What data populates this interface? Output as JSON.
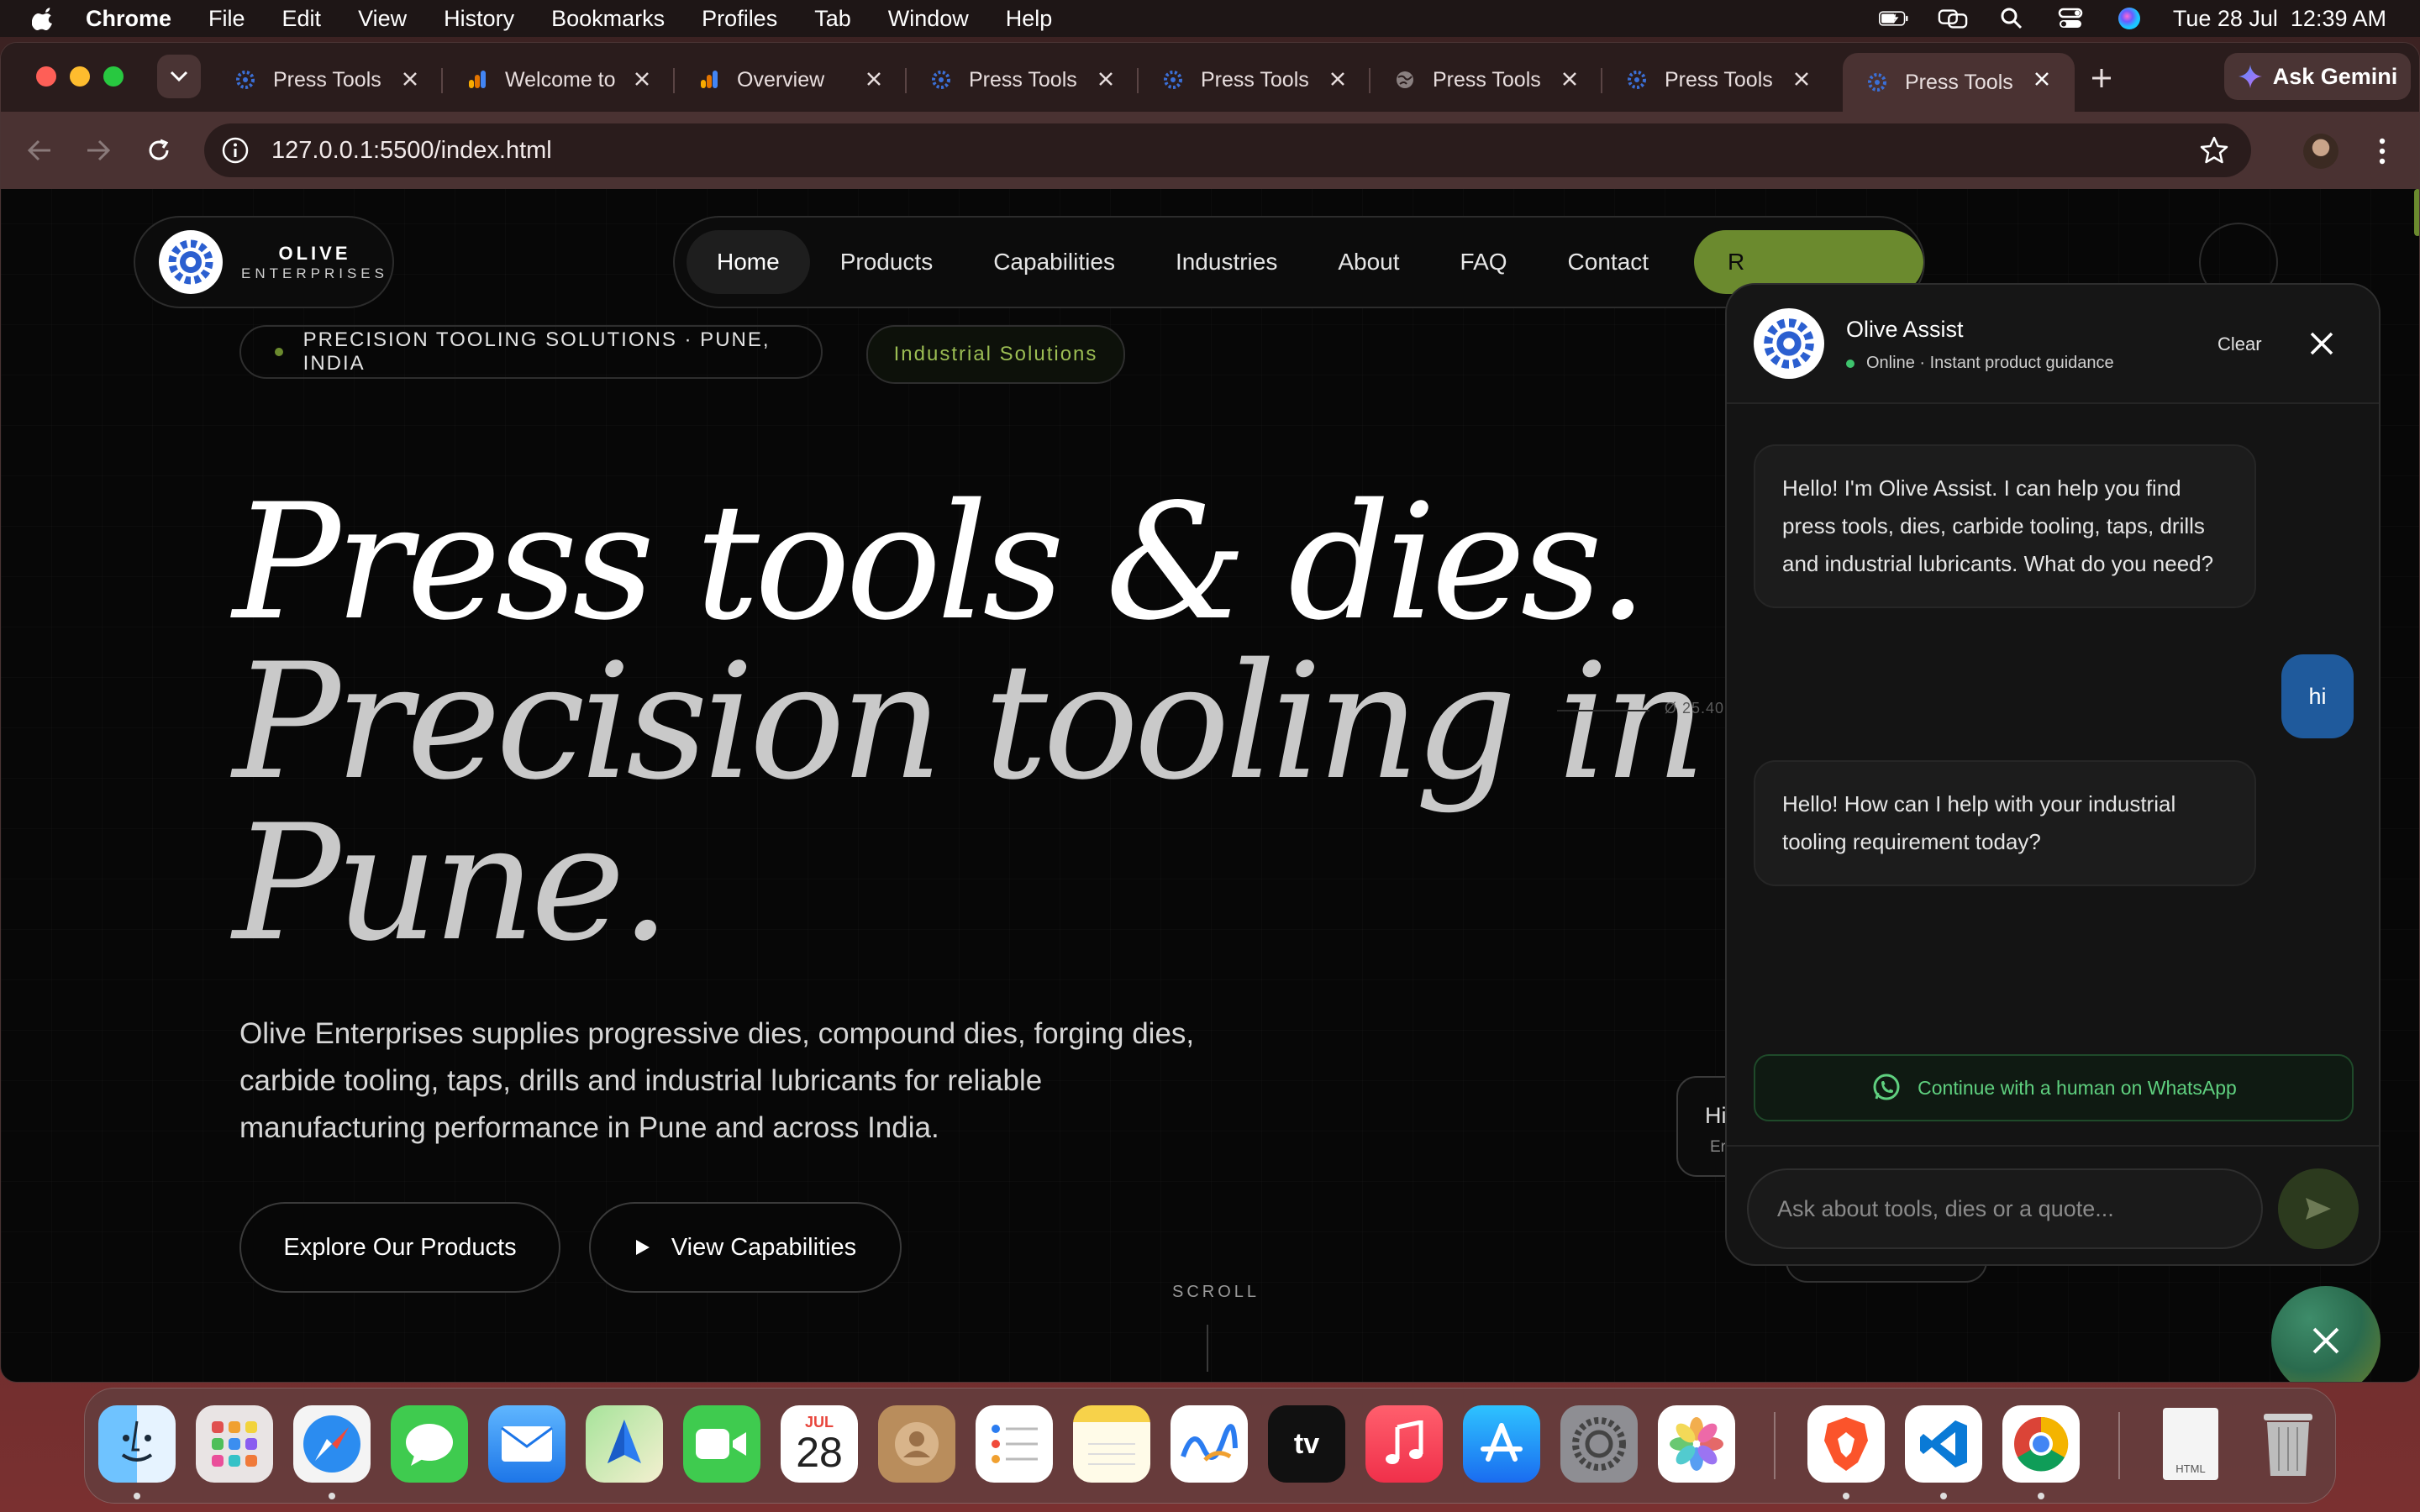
{
  "menubar": {
    "app": "Chrome",
    "items": [
      "File",
      "Edit",
      "View",
      "History",
      "Bookmarks",
      "Profiles",
      "Tab",
      "Window",
      "Help"
    ],
    "clock": "Tue 28 Jul  12:39 AM"
  },
  "browser": {
    "tabs": [
      {
        "title": "Press Tools",
        "favicon": "gear-favicon-icon"
      },
      {
        "title": "Welcome to",
        "favicon": "analytics-favicon-icon"
      },
      {
        "title": "Overview",
        "favicon": "analytics-favicon-icon"
      },
      {
        "title": "Press Tools",
        "favicon": "gear-favicon-icon"
      },
      {
        "title": "Press Tools",
        "favicon": "gear-favicon-icon"
      },
      {
        "title": "Press Tools",
        "favicon": "globe-favicon-icon"
      },
      {
        "title": "Press Tools",
        "favicon": "gear-favicon-icon"
      },
      {
        "title": "Press Tools",
        "favicon": "gear-favicon-icon",
        "active": true
      }
    ],
    "gemini_label": "Ask Gemini",
    "url": "127.0.0.1:5500/index.html"
  },
  "site": {
    "logo": {
      "name": "OLIVE",
      "sub": "ENTERPRISES"
    },
    "nav": [
      "Home",
      "Products",
      "Capabilities",
      "Industries",
      "About",
      "FAQ",
      "Contact"
    ],
    "nav_cta": "R",
    "badge_location": "PRECISION TOOLING SOLUTIONS · PUNE, INDIA",
    "badge_category": "Industrial Solutions",
    "hero_line1": "Press tools & dies.",
    "hero_line2": "Precision tooling in",
    "hero_line3": "Pune.",
    "description": "Olive Enterprises supplies progressive dies, compound dies, forging dies, carbide tooling, taps, drills and industrial lubricants for reliable manufacturing performance in Pune and across India.",
    "btn_explore": "Explore Our Products",
    "btn_capabilities": "View Capabilities",
    "scroll_label": "SCROLL",
    "dimension_label": "Ø 25.40",
    "card_hi": "Hi",
    "card_en": "Er"
  },
  "chat": {
    "title": "Olive Assist",
    "status": "Online · Instant product guidance",
    "clear_label": "Clear",
    "messages": [
      {
        "from": "bot",
        "text": "Hello! I'm Olive Assist. I can help you find press tools, dies, carbide tooling, taps, drills and industrial lubricants. What do you need?"
      },
      {
        "from": "user",
        "text": "hi"
      },
      {
        "from": "bot",
        "text": "Hello! How can I help with your industrial tooling requirement today?"
      }
    ],
    "whatsapp_label": "Continue with a human on WhatsApp",
    "input_placeholder": "Ask about tools, dies or a quote..."
  },
  "dock": {
    "apps": [
      "Finder",
      "Launchpad",
      "Safari",
      "Messages",
      "Mail",
      "Maps",
      "FaceTime",
      "Calendar",
      "Contacts",
      "Reminders",
      "Notes",
      "Freeform",
      "TV",
      "Music",
      "App Store",
      "System Settings",
      "Photos",
      "Brave",
      "VS Code",
      "Chrome",
      "HTML File",
      "Trash"
    ],
    "calendar_month": "JUL",
    "calendar_day": "28",
    "html_file_label": "HTML"
  },
  "colors": {
    "accent_olive": "#6b8a2e",
    "user_bubble": "#1f5a9c",
    "whatsapp_green": "#5fd07f",
    "page_bg": "#070707"
  }
}
